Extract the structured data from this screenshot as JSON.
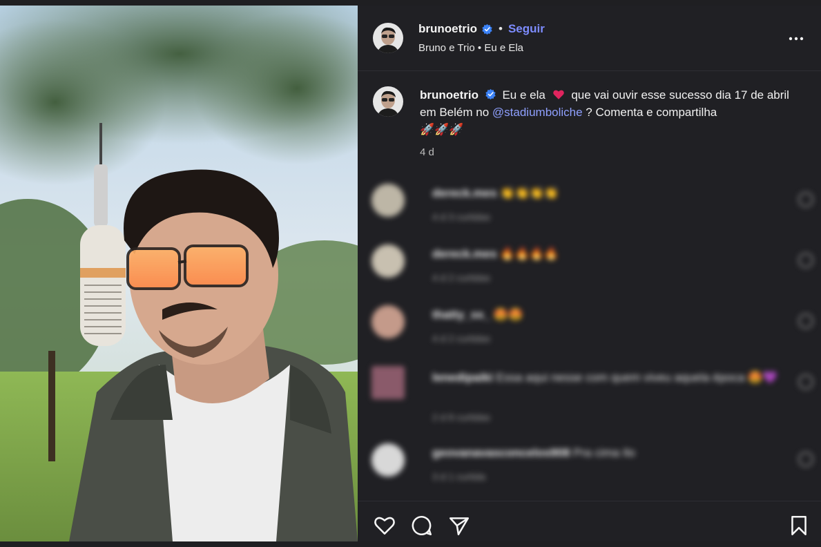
{
  "post": {
    "username": "brunoetrio",
    "follow_label": "Seguir",
    "subtitle_artist": "Bruno e Trio",
    "subtitle_song": "Eu e Ela",
    "caption_part1": "Eu e ela",
    "caption_part2": "que vai ouvir esse sucesso dia 17 de abril em Belém no",
    "caption_mention": "@stadiumboliche",
    "caption_part3": "? Comenta e compartilha",
    "caption_emojis": "🚀🚀🚀",
    "time": "4 d"
  },
  "comments": [
    {
      "user": "dereck.mes",
      "text": "👏👏👏👏",
      "meta": "4 d   3 curtidas",
      "avatar_color": "#bdb6a6"
    },
    {
      "user": "dereck.mes",
      "text": "🔥🔥🔥🔥",
      "meta": "4 d   2 curtidas",
      "avatar_color": "#c8c0b0"
    },
    {
      "user": "thatty_ss_",
      "text": "😍😍",
      "meta": "4 d   2 curtidas",
      "avatar_color": "#c49a8a"
    },
    {
      "user": "lenedipaiki",
      "text": "Essa aqui nesse com quem viveu aquela época 😍💜",
      "meta": "2 d   8 curtidas",
      "avatar_color": "#8a5a6a"
    },
    {
      "user": "geovanavasconcelos908",
      "text": "Pra cima Ilo",
      "meta": "3 d   1 curtida",
      "avatar_color": "#d8d8d8"
    }
  ],
  "colors": {
    "accent": "#7d8cff",
    "mention": "#8fa0ff",
    "verified": "#3b82f6",
    "heart": "#e0245e"
  },
  "icons": [
    "verified-badge-icon",
    "more-options-icon",
    "heart-icon",
    "comment-icon",
    "share-icon",
    "bookmark-icon"
  ]
}
